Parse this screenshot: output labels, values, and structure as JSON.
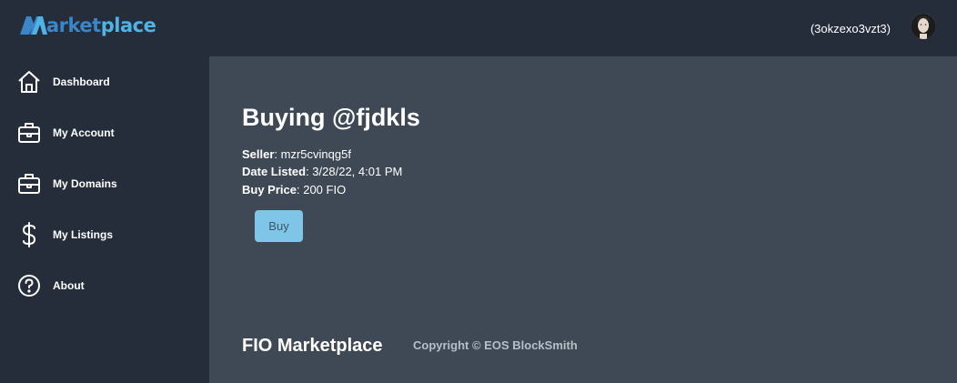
{
  "header": {
    "logo_text_prefix": "arket",
    "logo_text_suffix": "place",
    "account_name": "(3okzexo3vzt3)"
  },
  "sidebar": {
    "items": [
      {
        "label": "Dashboard",
        "icon": "home-icon"
      },
      {
        "label": "My Account",
        "icon": "briefcase-icon"
      },
      {
        "label": "My Domains",
        "icon": "briefcase-icon"
      },
      {
        "label": "My Listings",
        "icon": "dollar-icon"
      },
      {
        "label": "About",
        "icon": "help-circle-icon"
      }
    ]
  },
  "main": {
    "title": "Buying @fjdkls",
    "seller_label": "Seller",
    "seller_value": ": mzr5cvinqg5f",
    "date_label": "Date Listed",
    "date_value": ": 3/28/22, 4:01 PM",
    "price_label": "Buy Price",
    "price_value": ": 200 FIO",
    "buy_label": "Buy"
  },
  "footer": {
    "title": "FIO Marketplace",
    "copyright": "Copyright © EOS BlockSmith"
  },
  "colors": {
    "sidebar_bg": "#252d3b",
    "main_bg": "#3f4855",
    "accent": "#7ec5e8",
    "logo_dark": "#3a86c8",
    "logo_light": "#4fb3e4"
  }
}
